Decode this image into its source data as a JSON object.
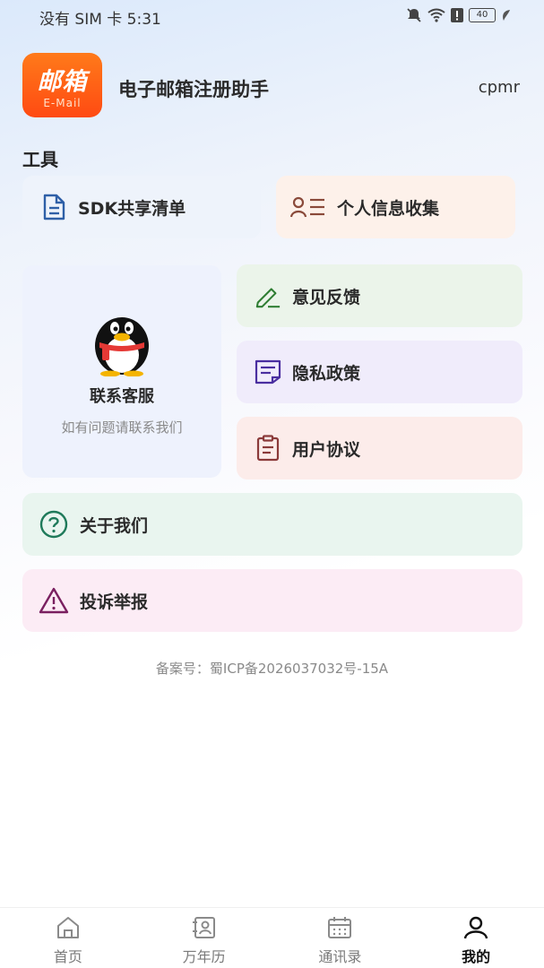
{
  "status_bar": {
    "carrier_time": "没有 SIM 卡 5:31",
    "battery": "40"
  },
  "header": {
    "logo_main": "邮箱",
    "logo_sub": "E-Mail",
    "title": "电子邮箱注册助手",
    "user": "cpmr"
  },
  "tools": {
    "section_title": "工具",
    "sdk_label": "SDK共享清单",
    "personal_label": "个人信息收集",
    "service_title": "联系客服",
    "service_subtitle": "如有问题请联系我们",
    "feedback_label": "意见反馈",
    "privacy_label": "隐私政策",
    "agreement_label": "用户协议",
    "about_label": "关于我们",
    "report_label": "投诉举报"
  },
  "icp": "备案号：蜀ICP备2026037032号-15A",
  "bottom_nav": [
    {
      "label": "首页",
      "icon": "home-icon"
    },
    {
      "label": "万年历",
      "icon": "contact-book-icon"
    },
    {
      "label": "通讯录",
      "icon": "calendar-icon"
    },
    {
      "label": "我的",
      "icon": "user-icon",
      "active": true
    }
  ],
  "colors": {
    "brand_orange": "#ff5a16",
    "sdk_icon": "#2e5fa7",
    "personal_icon": "#8a4a3a",
    "feedback_icon": "#2e7d32",
    "privacy_icon": "#4a2fa0",
    "agreement_icon": "#8b3a3a",
    "about_icon": "#1f7a5a",
    "report_icon": "#7a2060"
  }
}
